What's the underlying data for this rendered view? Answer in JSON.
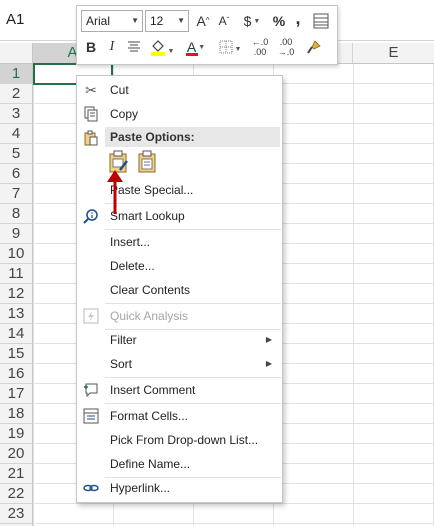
{
  "namebox": {
    "value": "A1"
  },
  "columns": {
    "first_visible": "A",
    "last_visible": "E"
  },
  "rows": [
    "1",
    "2",
    "3",
    "4",
    "5",
    "6",
    "7",
    "8",
    "9",
    "10",
    "11",
    "12",
    "13",
    "14",
    "15",
    "16",
    "17",
    "18",
    "19",
    "20",
    "21",
    "22",
    "23"
  ],
  "mini_toolbar": {
    "font_name": "Arial",
    "font_size": "12",
    "increase_font": "A",
    "decrease_font": "A",
    "currency": "$",
    "percent": "%",
    "comma": ",",
    "bold": "B",
    "italic": "I",
    "font_color_letter": "A",
    "decrease_decimal_top": "←.0",
    "decrease_decimal_bottom": ".00",
    "increase_decimal_top": ".00",
    "increase_decimal_bottom": "→.0",
    "font_color": "#e81123",
    "highlight_color": "#ffff00"
  },
  "context_menu": {
    "cut": "Cut",
    "copy": "Copy",
    "paste_options": "Paste Options:",
    "paste_special": "Paste Special...",
    "smart_lookup": "Smart Lookup",
    "insert": "Insert...",
    "delete": "Delete...",
    "clear_contents": "Clear Contents",
    "quick_analysis": "Quick Analysis",
    "filter": "Filter",
    "sort": "Sort",
    "insert_comment": "Insert Comment",
    "format_cells": "Format Cells...",
    "pick_from_list": "Pick From Drop-down List...",
    "define_name": "Define Name...",
    "hyperlink": "Hyperlink...",
    "submenu_glyph": "▶"
  },
  "colors": {
    "selection_green": "#217346",
    "arrow_red": "#c00000"
  }
}
